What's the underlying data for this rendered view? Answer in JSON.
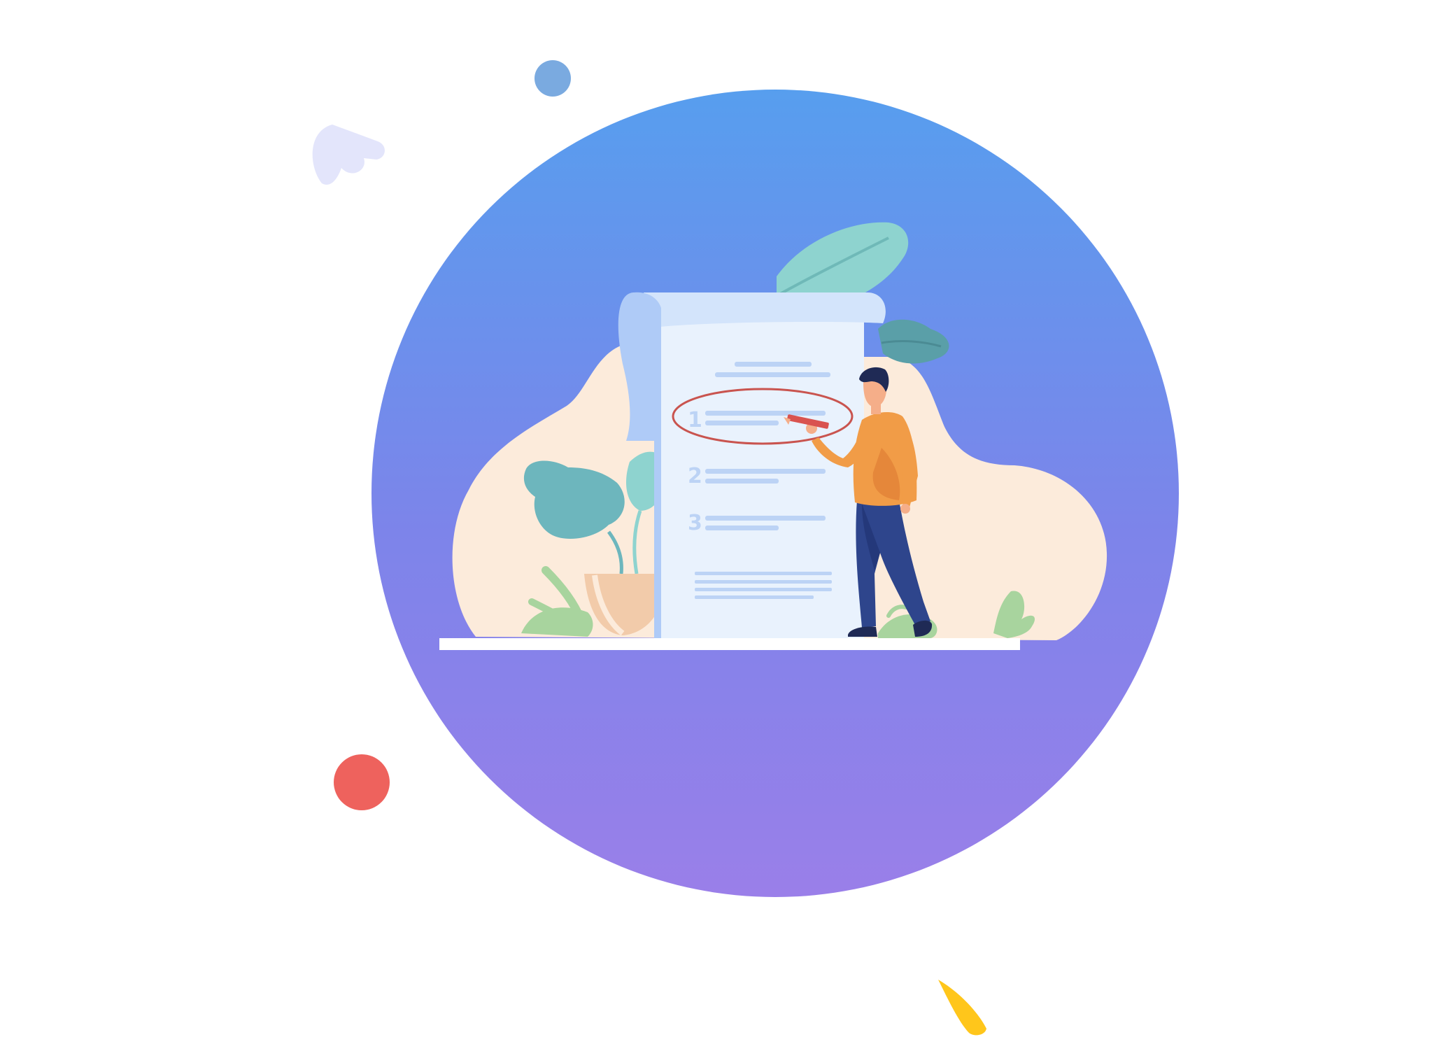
{
  "illustration": {
    "checklist": {
      "items": [
        {
          "number": "1"
        },
        {
          "number": "2"
        },
        {
          "number": "3"
        }
      ]
    }
  },
  "colors": {
    "circle_top": "#579EEE",
    "circle_mid": "#7D84EA",
    "circle_bottom": "#9A7FE9",
    "blob": "#FCEBDB",
    "paper": "#E9F2FD",
    "paper_roll": "#AFCBF7",
    "paper_line": "#BCD3F5",
    "highlight_ring": "#C9544F",
    "leaf_teal": "#6DB6BD",
    "leaf_light": "#8ED3CF",
    "leaf_dark": "#5A9FA8",
    "grass": "#A8D49E",
    "pot": "#F2CBAA",
    "shirt": "#F19C47",
    "pants": "#2E458C",
    "hair": "#1F2A55",
    "skin": "#F5AE89",
    "dot_blue": "#7AAAE0",
    "dot_red": "#EE625D",
    "dot_yellow": "#FFC61B",
    "wing_lavender": "#E3E5FB"
  },
  "icons": [
    "person-writing-icon",
    "checklist-paper-icon",
    "monstera-leaf-icon",
    "potted-plant-icon",
    "decorative-dot-icon",
    "decorative-feather-icon"
  ]
}
